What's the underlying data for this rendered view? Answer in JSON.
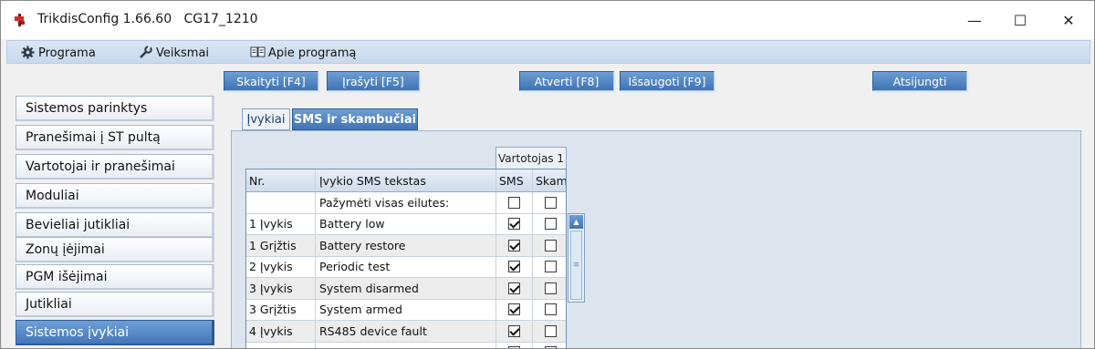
{
  "window": {
    "title": "TrikdisConfig 1.66.60",
    "device": "CG17_1210",
    "controls": {
      "minimize": "—",
      "maximize": "☐",
      "close": "✕"
    }
  },
  "menu": [
    {
      "label": "Programa",
      "icon": "gear-icon"
    },
    {
      "label": "Veiksmai",
      "icon": "wrench-icon"
    },
    {
      "label": "Apie programą",
      "icon": "book-icon"
    }
  ],
  "toolbar": {
    "read": "Skaityti [F4]",
    "write": "Įrašyti [F5]",
    "open": "Atverti [F8]",
    "save": "Išsaugoti [F9]",
    "disconnect": "Atsijungti"
  },
  "sidebar": {
    "items": [
      "Sistemos parinktys",
      "Pranešimai į ST pultą",
      "Vartotojai ir pranešimai",
      "Moduliai",
      "Bevieliai jutikliai",
      "Zonų įėjimai",
      "PGM išėjimai",
      "Jutikliai",
      "Sistemos įvykiai"
    ],
    "active_index": 8
  },
  "tabs": [
    {
      "label": "Įvykiai",
      "active": false
    },
    {
      "label": "SMS ir skambučiai",
      "active": true
    }
  ],
  "grid": {
    "group_header": "Vartotojas 1",
    "columns": {
      "nr": "Nr.",
      "text": "Įvykio SMS tekstas",
      "sms": "SMS",
      "call": "Skambutis"
    },
    "select_all_label": "Pažymėti visas eilutes:",
    "select_all": {
      "sms": false,
      "call": false
    },
    "rows": [
      {
        "nr": "1 Įvykis",
        "text": "Battery low",
        "sms": true,
        "call": false
      },
      {
        "nr": "1 Grįžtis",
        "text": "Battery restore",
        "sms": true,
        "call": false
      },
      {
        "nr": "2 Įvykis",
        "text": "Periodic test",
        "sms": true,
        "call": false
      },
      {
        "nr": "3 Įvykis",
        "text": "System disarmed",
        "sms": true,
        "call": false
      },
      {
        "nr": "3 Grįžtis",
        "text": "System armed",
        "sms": true,
        "call": false
      },
      {
        "nr": "4 Įvykis",
        "text": "RS485 device fault",
        "sms": true,
        "call": false
      },
      {
        "nr": "",
        "text": "",
        "sms": false,
        "call": false
      }
    ]
  }
}
